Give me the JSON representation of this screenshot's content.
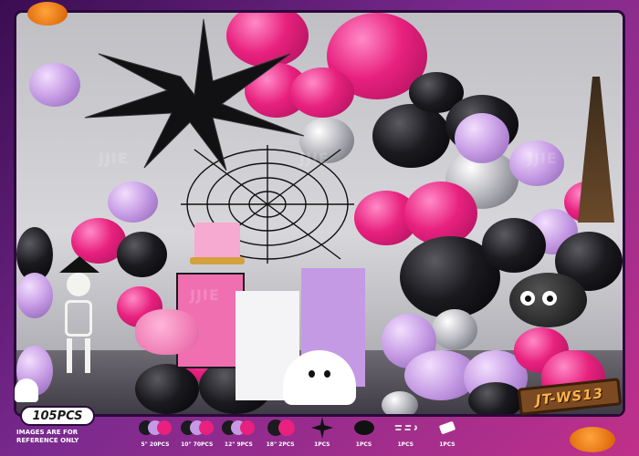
{
  "product": {
    "code": "JT-WS13",
    "pieces": "105PCS",
    "disclaimer_line1": "IMAGES ARE FOR",
    "disclaimer_line2": "REFERENCE ONLY",
    "watermark": "JJIE"
  },
  "contents": [
    {
      "label": "5\" 20PCS",
      "icon": "small-balloons-icon",
      "colors": [
        "#1a1a1f",
        "#c59ae4",
        "#e8217e"
      ]
    },
    {
      "label": "10\" 70PCS",
      "icon": "medium-balloons-icon",
      "colors": [
        "#1a1a1f",
        "#c59ae4",
        "#e8217e"
      ]
    },
    {
      "label": "12\" 9PCS",
      "icon": "large-balloons-icon",
      "colors": [
        "#1a1a1f",
        "#c59ae4",
        "#e8217e"
      ]
    },
    {
      "label": "18\" 2PCS",
      "icon": "xl-balloons-icon",
      "colors": [
        "#1a1a1f",
        "#e8217e"
      ]
    },
    {
      "label": "1PCS",
      "icon": "star-foil-balloon-icon",
      "colors": [
        "#111111"
      ]
    },
    {
      "label": "1PCS",
      "icon": "spider-foil-balloon-icon",
      "colors": [
        "#111111"
      ]
    },
    {
      "label": "1PCS",
      "icon": "balloon-chain-icon",
      "colors": [
        "#dddddd"
      ]
    },
    {
      "label": "1PCS",
      "icon": "glue-dots-icon",
      "colors": [
        "#ffffff"
      ]
    }
  ],
  "colors": {
    "frame_purple": "#7b2a8f",
    "hot_pink": "#e8217e",
    "lilac": "#c59ae4",
    "black": "#1a1a1f",
    "silver": "#b9b9c0",
    "badge_orange": "#ffb347"
  }
}
